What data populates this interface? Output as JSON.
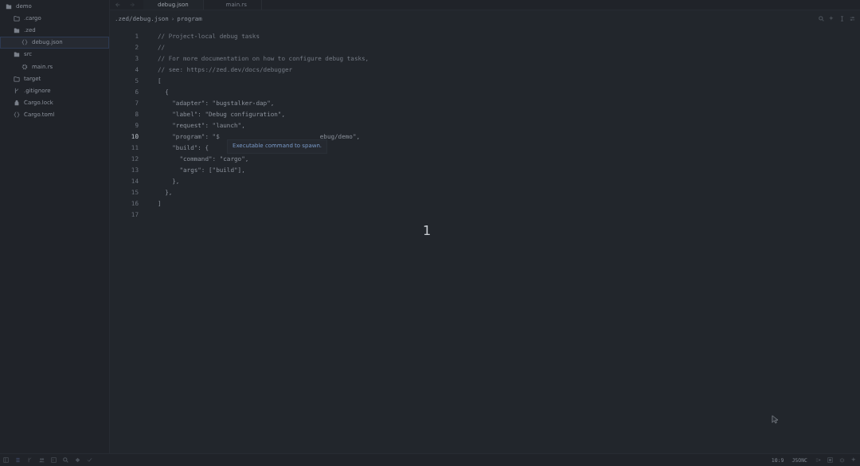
{
  "sidebar": {
    "items": [
      {
        "label": "demo",
        "kind": "folder-open",
        "selected": false,
        "children": [
          {
            "label": ".cargo",
            "kind": "folder",
            "selected": false
          },
          {
            "label": ".zed",
            "kind": "folder-open",
            "selected": false,
            "children": [
              {
                "label": "debug.json",
                "kind": "json",
                "selected": true
              }
            ]
          },
          {
            "label": "src",
            "kind": "folder-open",
            "selected": false,
            "children": [
              {
                "label": "main.rs",
                "kind": "rust",
                "selected": false
              }
            ]
          },
          {
            "label": "target",
            "kind": "folder",
            "selected": false
          },
          {
            "label": ".gitignore",
            "kind": "git",
            "selected": false
          },
          {
            "label": "Cargo.lock",
            "kind": "lock",
            "selected": false
          },
          {
            "label": "Cargo.toml",
            "kind": "json",
            "selected": false
          }
        ]
      }
    ]
  },
  "tabs": [
    {
      "label": "debug.json",
      "selected": true
    },
    {
      "label": "main.rs",
      "selected": false
    }
  ],
  "breadcrumb": {
    "path": ".zed/debug.json",
    "separator": "›",
    "symbol": "program"
  },
  "editor": {
    "lines": [
      {
        "number": "1",
        "kind": "comment",
        "text": "// Project-local debug tasks",
        "current": false
      },
      {
        "number": "2",
        "kind": "comment",
        "text": "//",
        "current": false
      },
      {
        "number": "3",
        "kind": "comment",
        "text": "// For more documentation on how to configure debug tasks,",
        "current": false
      },
      {
        "number": "4",
        "kind": "comment",
        "text": "// see: https://zed.dev/docs/debugger",
        "current": false
      },
      {
        "number": "5",
        "kind": "code",
        "text": "[",
        "current": false
      },
      {
        "number": "6",
        "kind": "code",
        "text": "  {",
        "current": false
      },
      {
        "number": "7",
        "kind": "code",
        "text": "    \"adapter\": \"bugstalker-dap\",",
        "current": false
      },
      {
        "number": "8",
        "kind": "code",
        "text": "    \"label\": \"Debug configuration\",",
        "current": false
      },
      {
        "number": "9",
        "kind": "code",
        "text": "    \"request\": \"launch\",",
        "current": false
      },
      {
        "number": "10",
        "kind": "code",
        "text": "    \"program\": \"$",
        "text_after": "ebug/demo\",",
        "current": true
      },
      {
        "number": "11",
        "kind": "code",
        "text": "    \"build\": {",
        "current": false
      },
      {
        "number": "12",
        "kind": "code",
        "text": "      \"command\": \"cargo\",",
        "current": false
      },
      {
        "number": "13",
        "kind": "code",
        "text": "      \"args\": [\"build\"],",
        "current": false
      },
      {
        "number": "14",
        "kind": "code",
        "text": "    },",
        "current": false
      },
      {
        "number": "15",
        "kind": "code",
        "text": "  },",
        "current": false
      },
      {
        "number": "16",
        "kind": "code",
        "text": "]",
        "current": false
      },
      {
        "number": "17",
        "current": false
      }
    ],
    "tooltip": "Executable command to spawn."
  },
  "keystroke": "1",
  "status_bar": {
    "position": "10:9",
    "language": "JSONC"
  }
}
